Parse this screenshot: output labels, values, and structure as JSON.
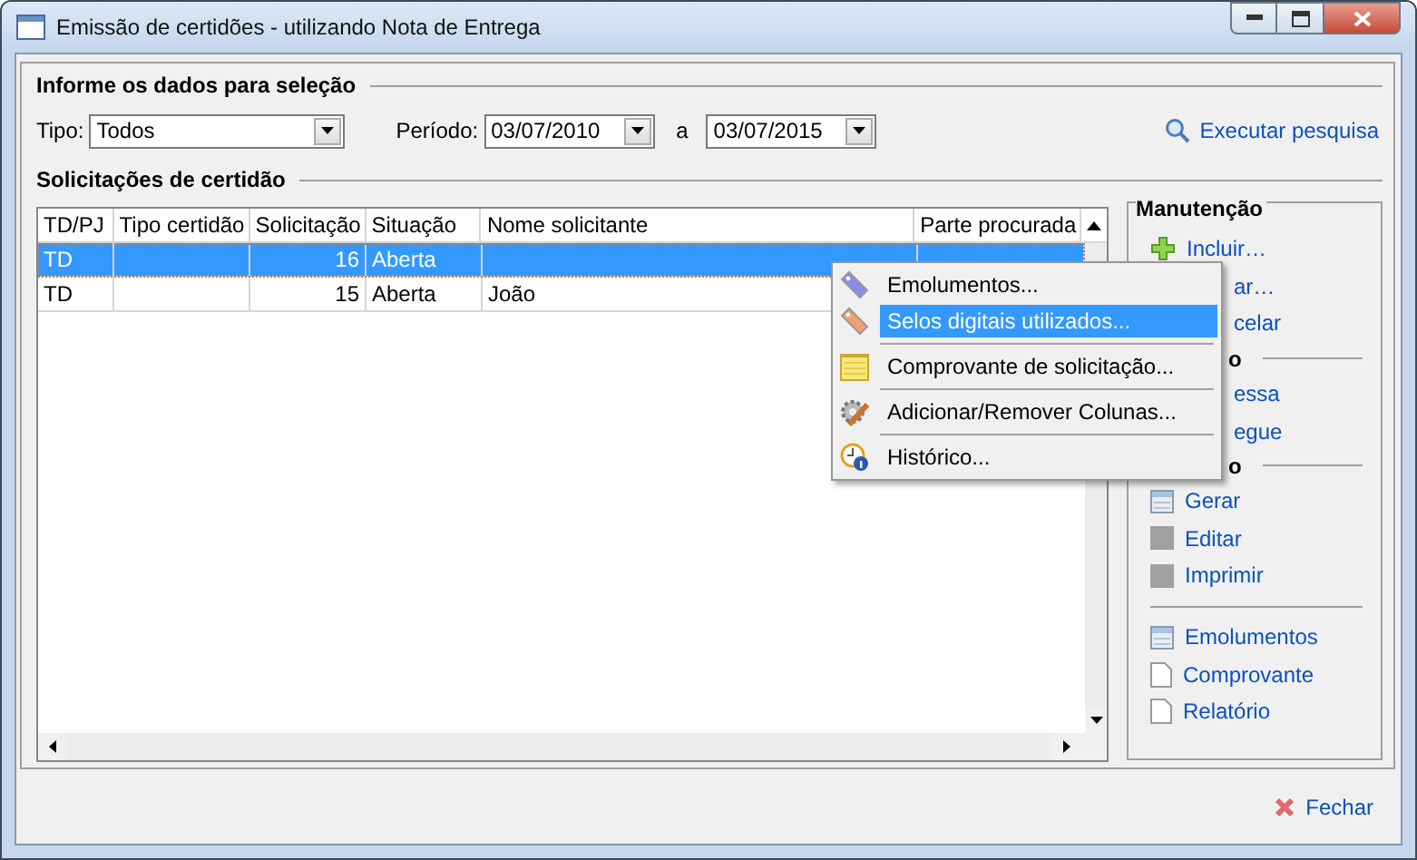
{
  "window": {
    "title": "Emissão de certidões - utilizando Nota de Entrega"
  },
  "selection": {
    "heading": "Informe os dados para seleção",
    "tipo_label": "Tipo:",
    "tipo_value": "Todos",
    "periodo_label": "Período:",
    "date_from": "03/07/2010",
    "between_label": "a",
    "date_to": "03/07/2015",
    "search_link": "Executar pesquisa"
  },
  "table": {
    "heading": "Solicitações de certidão",
    "columns": [
      "TD/PJ",
      "Tipo certidão",
      "Solicitação",
      "Situação",
      "Nome solicitante",
      "Parte procurada"
    ],
    "rows": [
      {
        "td_pj": "TD",
        "solicitacao": "16",
        "situacao": "Aberta",
        "selected": true
      },
      {
        "td_pj": "TD",
        "solicitacao": "15",
        "situacao": "Aberta",
        "nome_solicitante": "João",
        "selected": false
      }
    ]
  },
  "panel": {
    "heading": "Manutenção",
    "items": [
      {
        "kind": "add",
        "label": "Incluir…"
      },
      {
        "kind": "covered",
        "label": "ar…"
      },
      {
        "kind": "covered",
        "label": "celar"
      },
      {
        "kind": "covered-heading",
        "label": "o"
      },
      {
        "kind": "covered",
        "label": "essa"
      },
      {
        "kind": "covered",
        "label": "egue"
      },
      {
        "kind": "covered-heading",
        "label": "o"
      },
      {
        "kind": "grid",
        "label": "Gerar"
      },
      {
        "kind": "square",
        "label": "Editar"
      },
      {
        "kind": "square",
        "label": "Imprimir"
      },
      {
        "kind": "rule"
      },
      {
        "kind": "grid",
        "label": "Emolumentos"
      },
      {
        "kind": "page",
        "label": "Comprovante"
      },
      {
        "kind": "page",
        "label": "Relatório"
      }
    ]
  },
  "context_menu": {
    "items": [
      {
        "kind": "tag-blue",
        "label": "Emolumentos...",
        "selected": false
      },
      {
        "kind": "tag-orange",
        "label": "Selos digitais utilizados...",
        "selected": true
      },
      {
        "kind": "separator"
      },
      {
        "kind": "note",
        "label": "Comprovante de solicitação...",
        "selected": false
      },
      {
        "kind": "separator"
      },
      {
        "kind": "gear",
        "label": "Adicionar/Remover Colunas...",
        "selected": false
      },
      {
        "kind": "separator"
      },
      {
        "kind": "clock",
        "label": "Histórico...",
        "selected": false
      }
    ]
  },
  "footer": {
    "close_link": "Fechar"
  }
}
